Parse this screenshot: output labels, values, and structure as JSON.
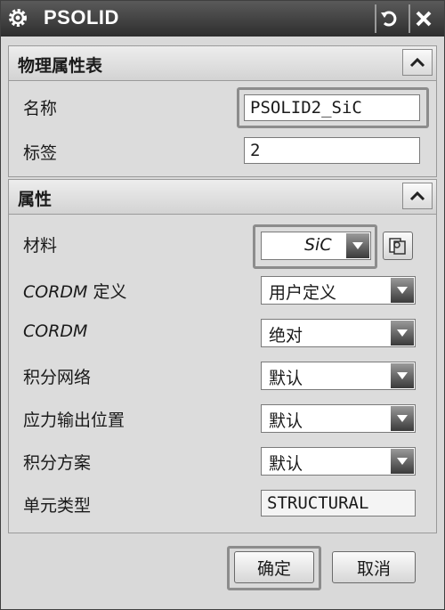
{
  "window": {
    "title": "PSOLID"
  },
  "sections": {
    "physical": {
      "title": "物理属性表",
      "name_label": "名称",
      "name_value": "PSOLID2_SiC",
      "tag_label": "标签",
      "tag_value": "2"
    },
    "props": {
      "title": "属性",
      "material_label": "材料",
      "material_value": "SiC",
      "cordm_def_label_latin": "CORDM",
      "cordm_def_label_cn": " 定义",
      "cordm_def_value": "用户定义",
      "cordm_label": "CORDM",
      "cordm_value": "绝对",
      "integration_net_label": "积分网络",
      "integration_net_value": "默认",
      "stress_output_label": "应力输出位置",
      "stress_output_value": "默认",
      "integration_scheme_label": "积分方案",
      "integration_scheme_value": "默认",
      "element_type_label": "单元类型",
      "element_type_value": "STRUCTURAL"
    }
  },
  "footer": {
    "ok_label": "确定",
    "cancel_label": "取消"
  }
}
